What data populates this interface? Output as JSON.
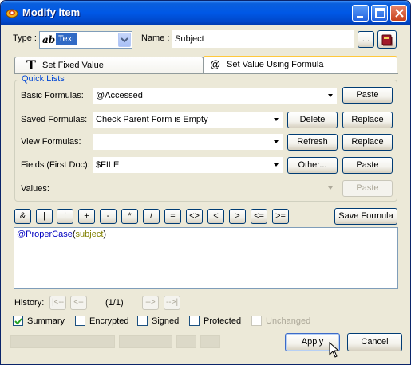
{
  "window": {
    "title": "Modify item"
  },
  "form": {
    "type_label": "Type :",
    "type_icon_text": "ab",
    "type_value": "Text",
    "name_label": "Name :",
    "name_value": "Subject",
    "browse_label": "..."
  },
  "tabs": [
    {
      "label": "Set Fixed Value",
      "icon": "T"
    },
    {
      "label": "Set Value Using Formula",
      "icon": "@"
    }
  ],
  "quick_lists": {
    "title": "Quick Lists",
    "rows": [
      {
        "label": "Basic Formulas:",
        "value": "@Accessed"
      },
      {
        "label": "Saved Formulas:",
        "value": "Check Parent Form is Empty"
      },
      {
        "label": "View Formulas:",
        "value": ""
      },
      {
        "label": "Fields (First Doc):",
        "value": "$FILE"
      },
      {
        "label": "Values:",
        "value": ""
      }
    ],
    "buttons": {
      "paste": "Paste",
      "delete": "Delete",
      "replace": "Replace",
      "refresh": "Refresh",
      "other": "Other...",
      "save_formula": "Save Formula"
    }
  },
  "operators": [
    "&",
    "|",
    "!",
    "+",
    "-",
    "*",
    "/",
    "=",
    "<>",
    "<",
    ">",
    "<=",
    ">="
  ],
  "formula": {
    "function": "@ProperCase",
    "open": "(",
    "arg": "subject",
    "close": ")"
  },
  "history": {
    "label": "History:",
    "first": "|<--",
    "prev": "<--",
    "position": "(1/1)",
    "next": "-->",
    "last": "-->|"
  },
  "options": [
    {
      "label": "Summary",
      "checked": true,
      "enabled": true
    },
    {
      "label": "Encrypted",
      "checked": false,
      "enabled": true
    },
    {
      "label": "Signed",
      "checked": false,
      "enabled": true
    },
    {
      "label": "Protected",
      "checked": false,
      "enabled": true
    },
    {
      "label": "Unchanged",
      "checked": false,
      "enabled": false
    }
  ],
  "actions": {
    "apply": "Apply",
    "cancel": "Cancel"
  },
  "colors": {
    "titlebar": "#0058e6",
    "accent": "#0046d5",
    "selection": "#316ac5"
  }
}
